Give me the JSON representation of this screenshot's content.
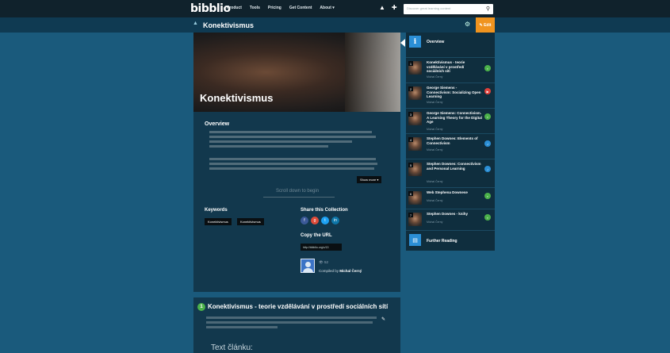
{
  "topbar": {
    "logo": "bibblio",
    "nav": [
      "Product",
      "Tools",
      "Pricing",
      "Get Content",
      "About ▾"
    ],
    "search_placeholder": "Discover great learning content"
  },
  "collection": {
    "title": "Konektivismus",
    "edit_label": "✎ Edit"
  },
  "hero": {
    "title": "Konektivismus"
  },
  "overview": {
    "heading": "Overview",
    "show_more": "Show more ▾",
    "scroll_hint": "Scroll down to begin"
  },
  "keywords": {
    "heading": "Keywords",
    "tags": [
      "Konektivismus",
      "Konektivismus"
    ]
  },
  "share": {
    "heading": "Share this Collection",
    "icons": [
      "facebook-icon",
      "google-plus-icon",
      "twitter-icon",
      "linkedin-icon"
    ],
    "colors": [
      "#3b5998",
      "#dd4b39",
      "#1da1f2",
      "#0e76a8"
    ]
  },
  "copy_url": {
    "heading": "Copy the URL",
    "url": "http://bibblio.org/c/13"
  },
  "compiler": {
    "prefix": "Compiled by",
    "name": "Michal Černý",
    "views": "👁 52"
  },
  "article": {
    "number": "1",
    "title": "Konektivismus - teorie vzdělávání v prostředí sociálních sítí",
    "text_heading": "Text článku:"
  },
  "sidebar": {
    "overview_label": "Overview",
    "items": [
      {
        "num": "1",
        "title": "Konektivismus - teorie vzdělávání v prostředí sociálních sítí",
        "sub": "Michal Černý",
        "badge_color": "#4bb24a",
        "badge_icon": "doc-icon"
      },
      {
        "num": "2",
        "title": "George Siemens - Connectivism: Socializing Open Learning",
        "sub": "Michal Černý",
        "badge_color": "#e0403a",
        "badge_icon": "video-icon"
      },
      {
        "num": "3",
        "title": "George Siemens: Connectivism. A Learning Theory for the Digital Age",
        "sub": "Michal Černý",
        "badge_color": "#4bb24a",
        "badge_icon": "doc-icon"
      },
      {
        "num": "4",
        "title": "Stephen Downes: Elements of Connectivism",
        "sub": "Michal Černý",
        "badge_color": "#2b8fd6",
        "badge_icon": "audio-icon"
      },
      {
        "num": "5",
        "title": "Stephen Downes: Connectivism and Personal Learning",
        "sub": "Michal Černý",
        "badge_color": "#2b8fd6",
        "badge_icon": "audio-icon"
      },
      {
        "num": "6",
        "title": "Web Stephena Downese",
        "sub": "Michal Černý",
        "badge_color": "#4bb24a",
        "badge_icon": "doc-icon"
      },
      {
        "num": "7",
        "title": "Stephen Downes - knihy",
        "sub": "Michal Černý",
        "badge_color": "#4bb24a",
        "badge_icon": "doc-icon"
      }
    ],
    "further_reading": "Further Reading"
  }
}
